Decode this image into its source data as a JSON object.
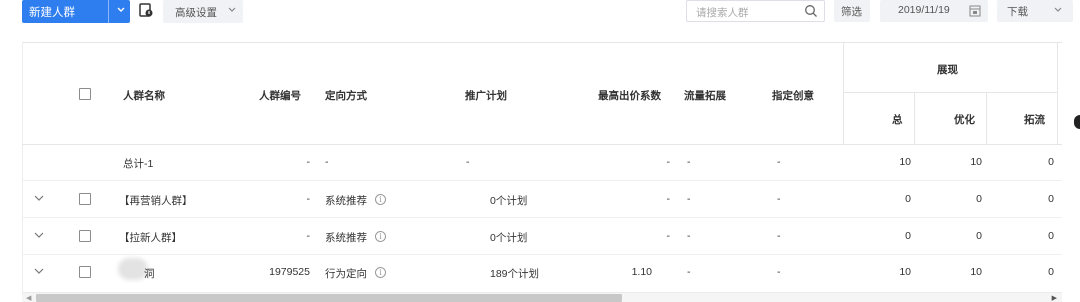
{
  "toolbar": {
    "new_group_label": "新建人群",
    "advanced_label": "高级设置",
    "search_placeholder": "请搜索人群",
    "filter_label": "筛选",
    "date_value": "2019/11/19",
    "download_label": "下载"
  },
  "table": {
    "headers": {
      "name": "人群名称",
      "id": "人群编号",
      "targeting": "定向方式",
      "plan": "推广计划",
      "max_bid": "最高出价系数",
      "traffic_expand": "流量拓展",
      "creative": "指定创意",
      "impressions_group": "展现",
      "total": "总",
      "optimized": "优化",
      "expanded": "拓流"
    },
    "rows": [
      {
        "name": "总计-1",
        "id": "-",
        "targeting": "-",
        "plan": "-",
        "max_bid": "-",
        "traffic_expand": "-",
        "creative": "-",
        "total": "10",
        "optimized": "10",
        "expanded": "0"
      },
      {
        "name": "【再营销人群】",
        "id": "-",
        "targeting": "系统推荐",
        "plan": "0个计划",
        "max_bid": "-",
        "traffic_expand": "-",
        "creative": "-",
        "total": "0",
        "optimized": "0",
        "expanded": "0"
      },
      {
        "name": "【拉新人群】",
        "id": "-",
        "targeting": "系统推荐",
        "plan": "0个计划",
        "max_bid": "-",
        "traffic_expand": "-",
        "creative": "-",
        "total": "0",
        "optimized": "0",
        "expanded": "0"
      },
      {
        "name": "洞",
        "id": "1979525",
        "targeting": "行为定向",
        "plan": "189个计划",
        "max_bid": "1.10",
        "traffic_expand": "-",
        "creative": "-",
        "total": "10",
        "optimized": "10",
        "expanded": "0"
      }
    ]
  },
  "info_glyph": "i",
  "colors": {
    "primary": "#2f7ef0",
    "button_bg": "#f0f2f5"
  }
}
